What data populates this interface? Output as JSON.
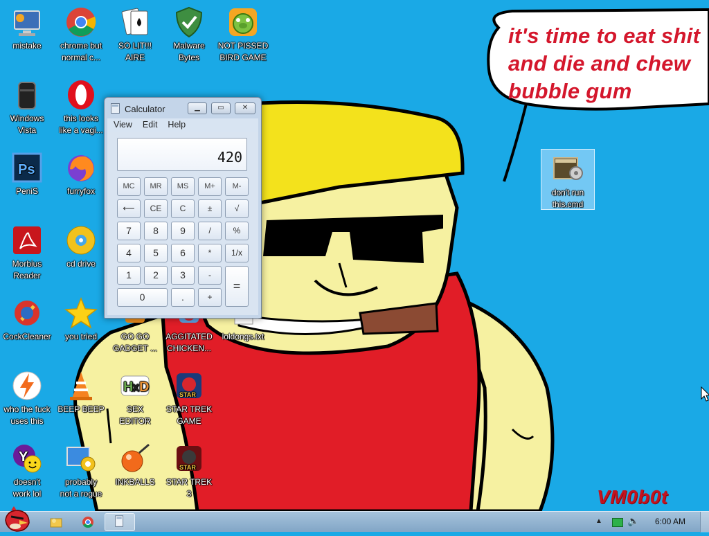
{
  "desktop": {
    "icons": [
      {
        "label": "mistake",
        "icon": "computer-icon"
      },
      {
        "label": "chrome but\nnormal c...",
        "icon": "chrome-icon"
      },
      {
        "label": "SO LIT!!!\nAIRE",
        "icon": "solitaire-icon"
      },
      {
        "label": "Malware\nBytes",
        "icon": "shield-icon"
      },
      {
        "label": "NOT PISSED\nBIRD GAME",
        "icon": "green-pig-icon"
      },
      {
        "label": "Windows\nVista",
        "icon": "trash-bin-icon"
      },
      {
        "label": "this looks\nlike a vagi...",
        "icon": "opera-icon"
      },
      {
        "label": "PeniS",
        "icon": "photoshop-icon"
      },
      {
        "label": "furryfox",
        "icon": "firefox-icon"
      },
      {
        "label": "Morbius\nReader",
        "icon": "pdf-reader-icon"
      },
      {
        "label": "cd drive",
        "icon": "cd-icon"
      },
      {
        "label": "CockCleaner",
        "icon": "cleaner-icon"
      },
      {
        "label": "you tried",
        "icon": "star-icon"
      },
      {
        "label": "GO GO\nGADGET ...",
        "icon": "gadget-icon"
      },
      {
        "label": "AGGITATED\nCHICKEN...",
        "icon": "chicken-icon"
      },
      {
        "label": "loldongs.txt",
        "icon": "text-file-icon"
      },
      {
        "label": "who the fuck\nuses this",
        "icon": "lightning-icon"
      },
      {
        "label": "BEEP BEEP",
        "icon": "vlc-cone-icon"
      },
      {
        "label": "SEX\nEDITOR",
        "icon": "hex-editor-icon"
      },
      {
        "label": "STAR TREK\nGAME",
        "icon": "star-wars-game-icon"
      },
      {
        "label": "doesn't\nwork lol",
        "icon": "yahoo-icon"
      },
      {
        "label": "probably\nnot a rogue",
        "icon": "gear-monitor-icon"
      },
      {
        "label": "INKBALLS",
        "icon": "inkball-icon"
      },
      {
        "label": "STAR TREK\n3",
        "icon": "star-wars-game-icon"
      },
      {
        "label": "don't run\nthis.cmd",
        "icon": "cmd-file-icon"
      }
    ],
    "bubble_text": "it's time to eat shit and die and chew bubble gum",
    "signature": "VM0b0t"
  },
  "calculator": {
    "title": "Calculator",
    "menu": [
      "View",
      "Edit",
      "Help"
    ],
    "display": "420",
    "memory_keys": [
      "MC",
      "MR",
      "MS",
      "M+",
      "M-"
    ],
    "keys": {
      "backspace": "⟵",
      "ce": "CE",
      "c": "C",
      "plusminus": "±",
      "sqrt": "√",
      "k7": "7",
      "k8": "8",
      "k9": "9",
      "div": "/",
      "pct": "%",
      "k4": "4",
      "k5": "5",
      "k6": "6",
      "mul": "*",
      "recip": "1/x",
      "k1": "1",
      "k2": "2",
      "k3": "3",
      "sub": "-",
      "eq": "=",
      "k0": "0",
      "dot": ".",
      "add": "+"
    }
  },
  "taskbar": {
    "time": "6:00 AM"
  }
}
